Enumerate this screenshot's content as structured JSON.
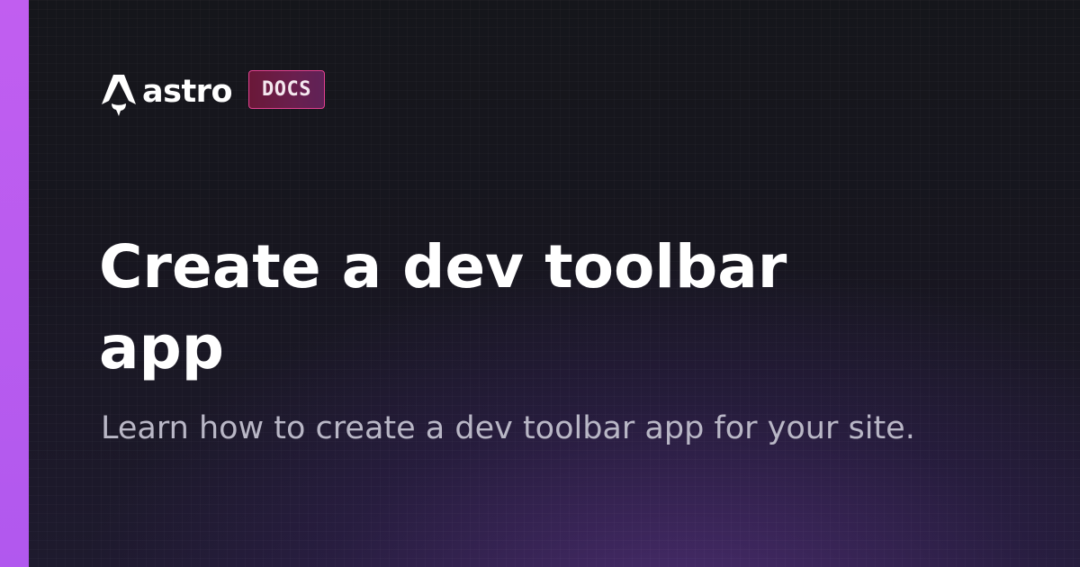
{
  "brand": {
    "wordmark": "astro",
    "icon": "astro-rocket-logo-icon",
    "badge_label": "DOCS"
  },
  "page": {
    "title": "Create a dev toolbar app",
    "description": "Learn how to create a dev toolbar app for your site."
  },
  "colors": {
    "accent_bar": "#b95cef",
    "badge_border": "#e2418f",
    "badge_fill": "#6a1f4e",
    "background": "#15161c",
    "title_text": "#ffffff",
    "description_text": "#b9b7c6"
  }
}
